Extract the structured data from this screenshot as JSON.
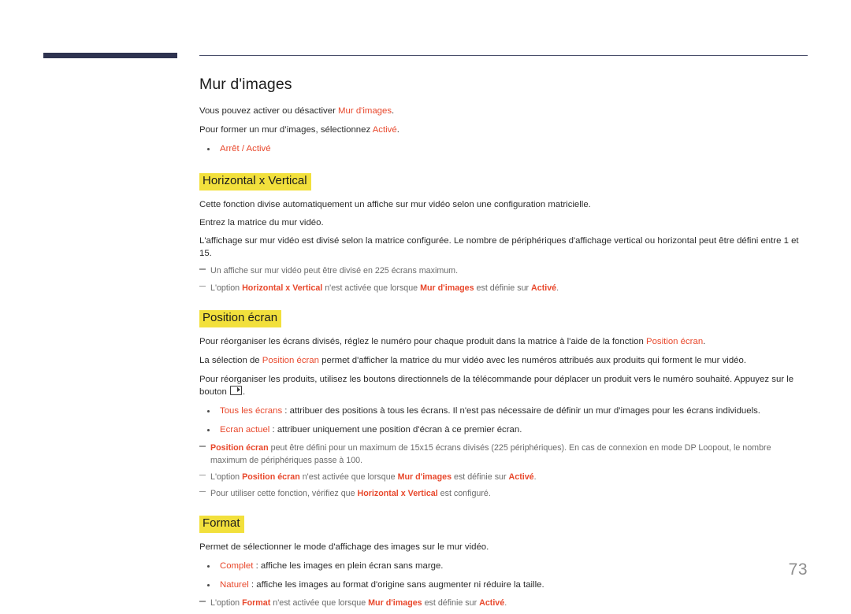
{
  "page": {
    "number": "73",
    "title": "Mur d'images"
  },
  "colors": {
    "accent_red": "#e8482c",
    "highlight_yellow": "#f2e03c",
    "header_bar_navy": "#2e3350",
    "note_gray": "#6b6b6b",
    "page_number_gray": "#8d8d8d"
  },
  "intro": {
    "line1_a": "Vous pouvez activer ou désactiver ",
    "line1_term": "Mur d'images",
    "line1_b": ".",
    "line2_a": "Pour former un mur d’images, sélectionnez ",
    "line2_term": "Activé",
    "line2_b": ".",
    "bullet1": "Arrêt / Activé"
  },
  "sections": [
    {
      "heading": "Horizontal x Vertical",
      "paragraphs": [
        "Cette fonction divise automatiquement un affiche sur mur vidéo selon une configuration matricielle.",
        "Entrez la matrice du mur vidéo.",
        "L'affichage sur mur vidéo est divisé selon la matrice configurée. Le nombre de périphériques d'affichage vertical ou horizontal peut être défini entre 1 et 15."
      ],
      "notes": [
        {
          "parts": [
            {
              "text": "Un affiche sur mur vidéo peut être divisé en 225 écrans maximum.",
              "style": "plain"
            }
          ]
        },
        {
          "parts": [
            {
              "text": "L'option ",
              "style": "plain"
            },
            {
              "text": "Horizontal x Vertical",
              "style": "accent-bold"
            },
            {
              "text": " n'est activée que lorsque ",
              "style": "plain"
            },
            {
              "text": "Mur d'images",
              "style": "accent-bold"
            },
            {
              "text": " est définie sur ",
              "style": "plain"
            },
            {
              "text": "Activé",
              "style": "accent-bold"
            },
            {
              "text": ".",
              "style": "plain"
            }
          ]
        }
      ]
    },
    {
      "heading": "Position écran",
      "paragraph1_a": "Pour réorganiser les écrans divisés, réglez le numéro pour chaque produit dans la matrice à l'aide de la fonction ",
      "paragraph1_term": "Position écran",
      "paragraph1_b": ".",
      "paragraph2_a": "La sélection de ",
      "paragraph2_term": "Position écran",
      "paragraph2_b": " permet d'afficher la matrice du mur vidéo avec les numéros attribués aux produits qui forment le mur vidéo.",
      "paragraph3_a": "Pour réorganiser les produits, utilisez les boutons directionnels de la télécommande pour déplacer un produit vers le numéro souhaité. Appuyez sur le bouton ",
      "paragraph3_b": ".",
      "enter_key_icon": "enter-key-icon",
      "bullets": [
        {
          "term": "Tous les écrans",
          "rest": " : attribuer des positions à tous les écrans. Il n'est pas nécessaire de définir un mur d’images pour les écrans individuels."
        },
        {
          "term": "Ecran actuel",
          "rest": " : attribuer uniquement une position d'écran à ce premier écran."
        }
      ],
      "notes": [
        {
          "parts": [
            {
              "text": "Position écran",
              "style": "accent-bold"
            },
            {
              "text": " peut être défini pour un maximum de 15x15 écrans divisés (225 périphériques). En cas de connexion en mode DP Loopout, le nombre maximum de périphériques passe à 100.",
              "style": "plain"
            }
          ]
        },
        {
          "parts": [
            {
              "text": "L'option ",
              "style": "plain"
            },
            {
              "text": "Position écran",
              "style": "accent-bold"
            },
            {
              "text": " n'est activée que lorsque ",
              "style": "plain"
            },
            {
              "text": "Mur d'images",
              "style": "accent-bold"
            },
            {
              "text": " est définie sur ",
              "style": "plain"
            },
            {
              "text": "Activé",
              "style": "accent-bold"
            },
            {
              "text": ".",
              "style": "plain"
            }
          ]
        },
        {
          "parts": [
            {
              "text": "Pour utiliser cette fonction, vérifiez que ",
              "style": "plain"
            },
            {
              "text": "Horizontal x Vertical",
              "style": "accent-bold"
            },
            {
              "text": " est configuré.",
              "style": "plain"
            }
          ]
        }
      ]
    },
    {
      "heading": "Format",
      "paragraph1": "Permet de sélectionner le mode d'affichage des images sur le mur vidéo.",
      "bullets": [
        {
          "term": "Complet",
          "rest": " : affiche les images en plein écran sans marge."
        },
        {
          "term": "Naturel",
          "rest": " : affiche les images au format d'origine sans augmenter ni réduire la taille."
        }
      ],
      "notes": [
        {
          "parts": [
            {
              "text": "L'option ",
              "style": "plain"
            },
            {
              "text": "Format",
              "style": "accent-bold"
            },
            {
              "text": " n'est activée que lorsque ",
              "style": "plain"
            },
            {
              "text": "Mur d'images",
              "style": "accent-bold"
            },
            {
              "text": " est définie sur ",
              "style": "plain"
            },
            {
              "text": "Activé",
              "style": "accent-bold"
            },
            {
              "text": ".",
              "style": "plain"
            }
          ]
        }
      ]
    }
  ]
}
